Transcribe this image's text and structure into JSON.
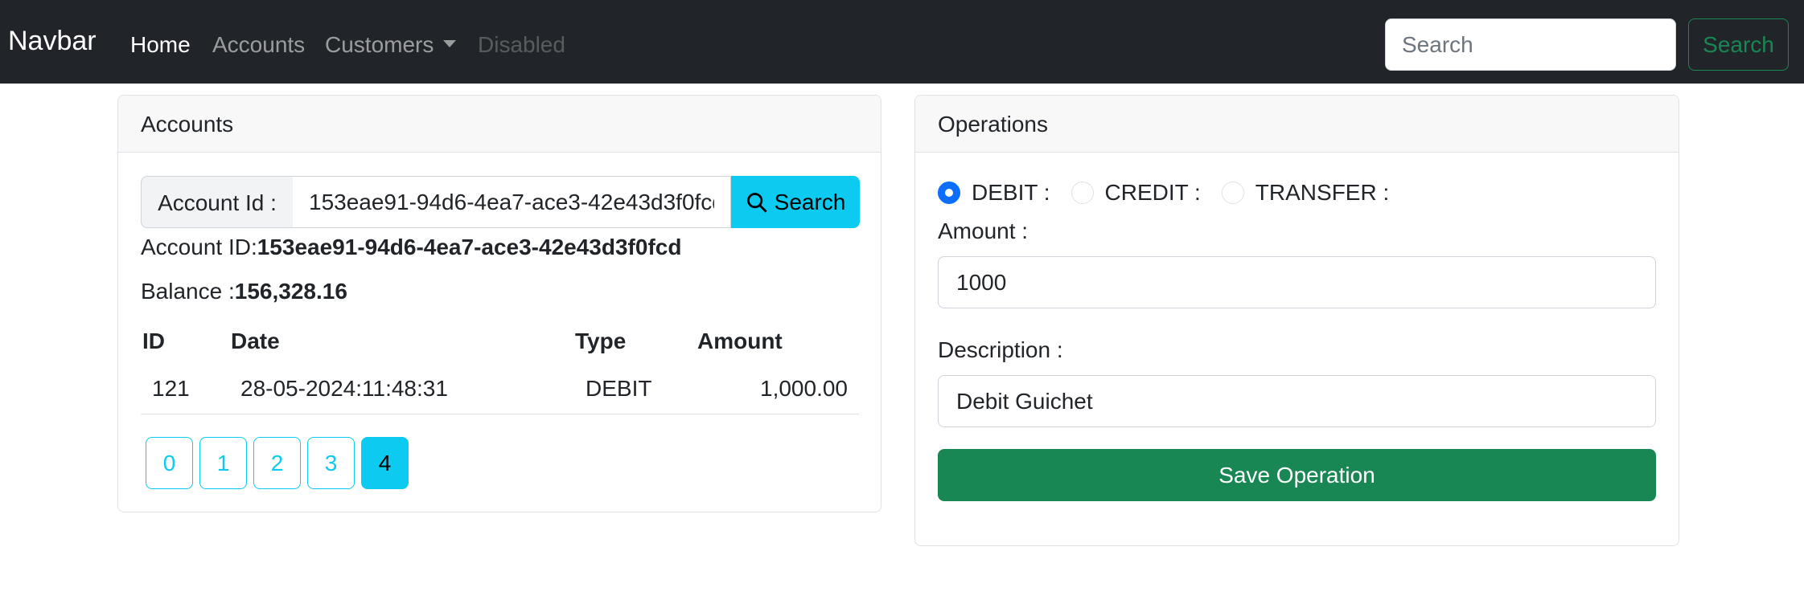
{
  "navbar": {
    "brand": "Navbar",
    "links": [
      {
        "label": "Home"
      },
      {
        "label": "Accounts"
      },
      {
        "label": "Customers"
      },
      {
        "label": "Disabled"
      }
    ],
    "search_placeholder": "Search",
    "search_button": "Search"
  },
  "accounts_card": {
    "header": "Accounts",
    "input_label": "Account Id :",
    "input_value": "153eae91-94d6-4ea7-ace3-42e43d3f0fcd",
    "search_button": "Search",
    "account_id_label": "Account ID:",
    "account_id_value": "153eae91-94d6-4ea7-ace3-42e43d3f0fcd",
    "balance_label": "Balance :",
    "balance_value": "156,328.16",
    "table": {
      "headers": [
        "ID",
        "Date",
        "Type",
        "Amount"
      ],
      "rows": [
        {
          "id": "121",
          "date": "28-05-2024:11:48:31",
          "type": "DEBIT",
          "amount": "1,000.00"
        }
      ]
    },
    "pages": [
      "0",
      "1",
      "2",
      "3",
      "4"
    ],
    "active_page": "4"
  },
  "operations_card": {
    "header": "Operations",
    "radios": [
      {
        "label": "DEBIT :",
        "checked": true
      },
      {
        "label": "CREDIT :",
        "checked": false
      },
      {
        "label": "TRANSFER :",
        "checked": false
      }
    ],
    "amount_label": "Amount :",
    "amount_value": "1000",
    "description_label": "Description :",
    "description_value": "Debit Guichet",
    "save_button": "Save Operation"
  },
  "colors": {
    "navbar_bg": "#212529",
    "info": "#0dcaf0",
    "success": "#198754",
    "primary": "#0d6efd"
  }
}
